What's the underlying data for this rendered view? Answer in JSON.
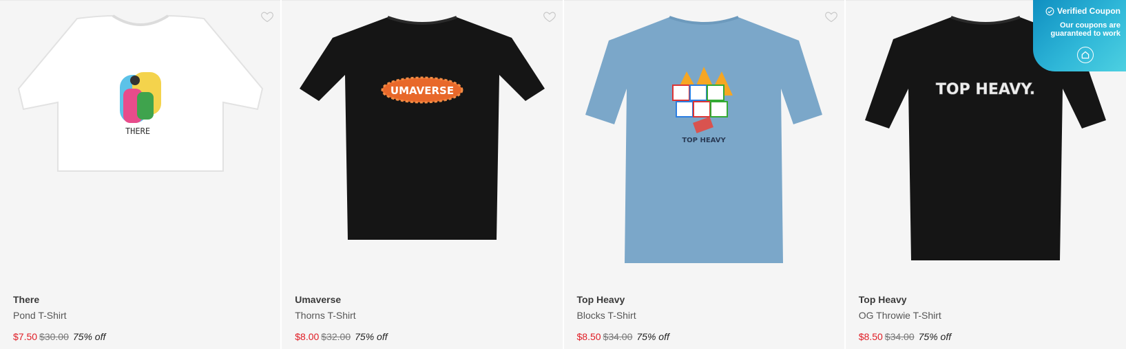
{
  "products": [
    {
      "brand": "There",
      "name": "Pond T-Shirt",
      "price": "$7.50",
      "original_price": "$30.00",
      "discount": "75% off",
      "shirt_color": "#ffffff",
      "style": "crop",
      "print_text": "THERE"
    },
    {
      "brand": "Umaverse",
      "name": "Thorns T-Shirt",
      "price": "$8.00",
      "original_price": "$32.00",
      "discount": "75% off",
      "shirt_color": "#151515",
      "style": "tee",
      "print_text": "UMAVERSE"
    },
    {
      "brand": "Top Heavy",
      "name": "Blocks T-Shirt",
      "price": "$8.50",
      "original_price": "$34.00",
      "discount": "75% off",
      "shirt_color": "#7ba7c9",
      "style": "tee",
      "print_text": "TOP HEAVY"
    },
    {
      "brand": "Top Heavy",
      "name": "OG Throwie T-Shirt",
      "price": "$8.50",
      "original_price": "$34.00",
      "discount": "75% off",
      "shirt_color": "#151515",
      "style": "tee",
      "print_text": "TOP HEAVY."
    }
  ],
  "coupon": {
    "title": "Verified Coupon",
    "line1": "Our coupons are",
    "line2": "guaranteed to work",
    "icon": "home-icon"
  },
  "icons": {
    "favorite": "heart-outline-icon",
    "verified": "check-circle-icon"
  },
  "colors": {
    "sale_price": "#e01c24",
    "coupon_gradient_start": "#0f8fc1",
    "coupon_gradient_end": "#4dd0e1"
  }
}
